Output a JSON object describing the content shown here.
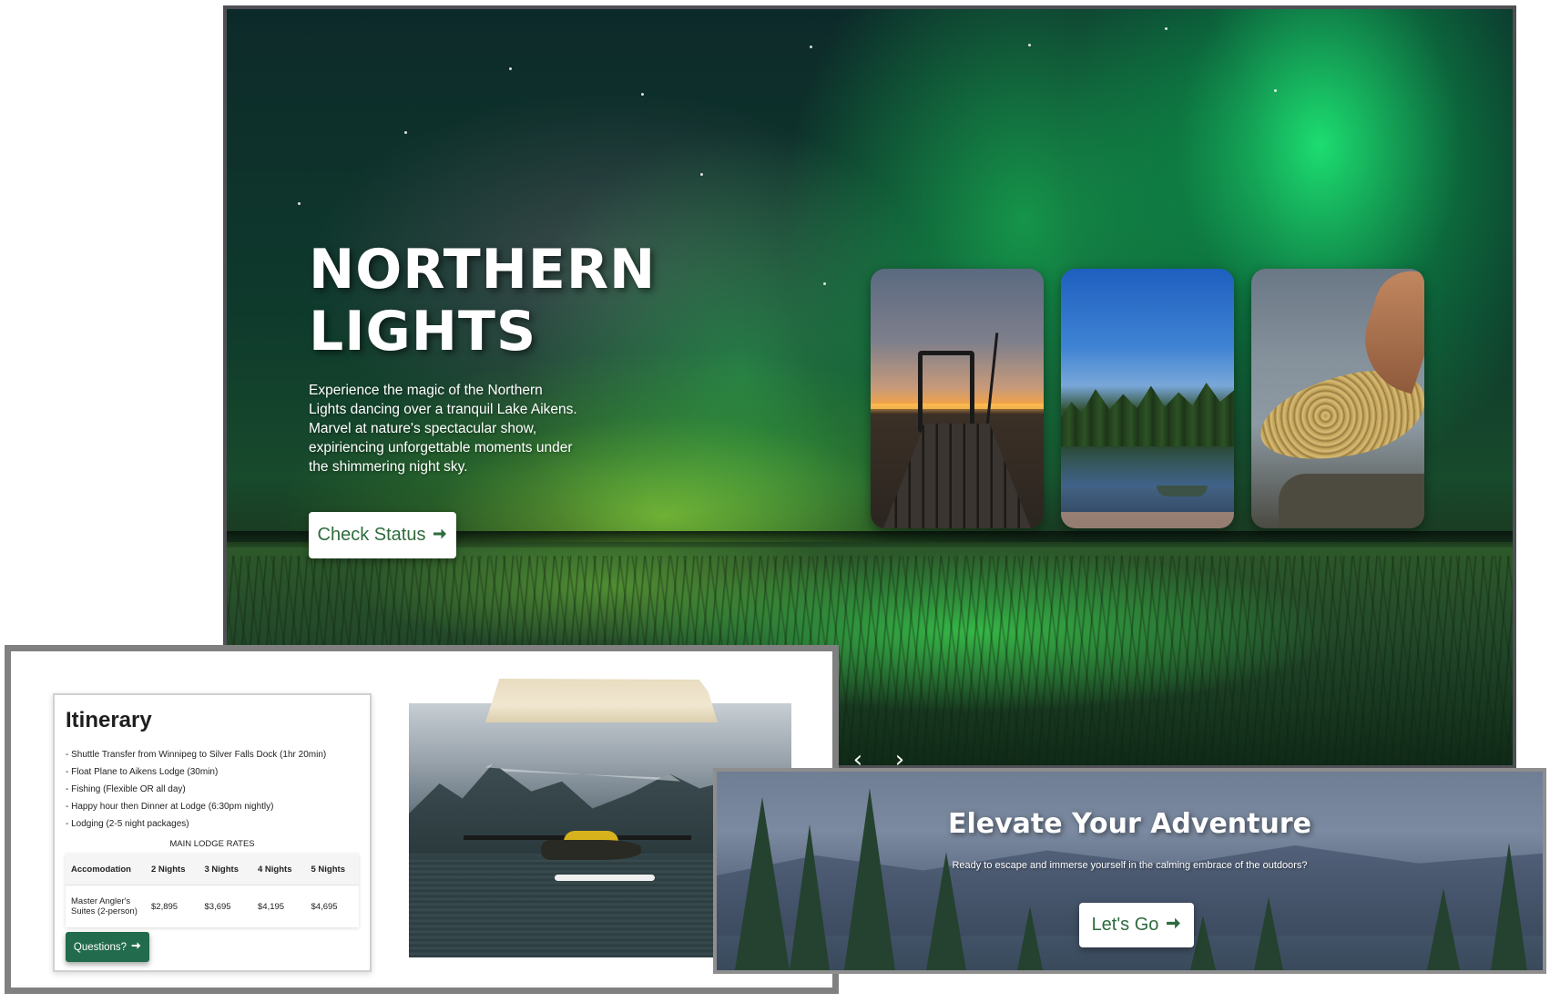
{
  "hero": {
    "title_line1": "NORTHERN",
    "title_line2": "LIGHTS",
    "description": "Experience the magic of the Northern Lights dancing over a tranquil Lake Aikens. Marvel at nature's spectacular show, expiriencing unforgettable moments under the shimmering night sky.",
    "cta_label": "Check Status",
    "cta_icon": "arrow-right-icon",
    "prev_icon": "chevron-left-icon",
    "next_icon": "chevron-right-icon"
  },
  "itinerary": {
    "title": "Itinerary",
    "items": [
      "- Shuttle Transfer from Winnipeg to Silver Falls Dock (1hr 20min)",
      "- Float Plane to Aikens Lodge (30min)",
      "- Fishing (Flexible OR all day)",
      "- Happy hour then Dinner at Lodge (6:30pm nightly)",
      "- Lodging (2-5 night packages)"
    ],
    "rates_caption": "MAIN LODGE RATES",
    "rates_headers": [
      "Accomodation",
      "2 Nights",
      "3 Nights",
      "4 Nights",
      "5 Nights"
    ],
    "rates_rows": [
      [
        "Master Angler's Suites (2-person)",
        "$2,895",
        "$3,695",
        "$4,195",
        "$4,695"
      ]
    ],
    "button_label": "Questions?",
    "button_icon": "arrow-right-icon"
  },
  "adventure": {
    "title": "Elevate Your Adventure",
    "subtitle": "Ready to escape and immerse yourself in the calming embrace of the outdoors?",
    "cta_label": "Let's Go",
    "cta_icon": "arrow-right-icon"
  },
  "colors": {
    "brand_green": "#226b4c",
    "button_text_green": "#2e6b3e",
    "aurora_green": "#1ee878"
  }
}
